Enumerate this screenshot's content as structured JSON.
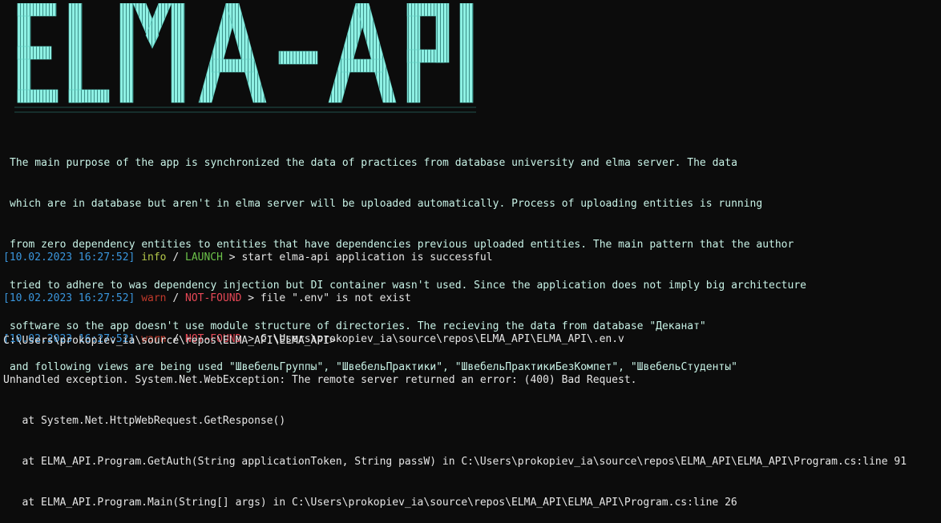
{
  "banner": {
    "text": "ELMA-API",
    "color": "#8ff1e4",
    "shadow": "#3fa7a0"
  },
  "description": [
    "The main purpose of the app is synchronized the data of practices from database university and elma server. The data",
    "which are in database but aren't in elma server will be uploaded automatically. Process of uploading entities is running",
    "from zero dependency entities to entities that have dependencies previous uploaded entities. The main pattern that the author",
    "tried to adhere to was dependency injection but DI container wasn't used. Since the application does not imply big architecture",
    "software so the app doesn't use module structure of directories. The recieving the data from database \"Деканат\"",
    "and following views are being used \"ШвебельГруппы\", \"ШвебельПрактики\", \"ШвебельПрактикиБезКомпет\", \"ШвебельСтуденты\""
  ],
  "logs": [
    {
      "timestamp": "[10.02.2023 16:27:52]",
      "level": "info",
      "tag": "LAUNCH",
      "message": " > start elma-api application is successful"
    },
    {
      "timestamp": "[10.02.2023 16:27:52]",
      "level": "warn",
      "tag": "NOT-FOUND",
      "message": " > file \".env\" is not exist"
    },
    {
      "timestamp": "[10.02.2023 16:27:52]",
      "level": "warn",
      "tag": "NOT-FOUND",
      "message": " > C:\\Users\\prokopiev_ia\\source\\repos\\ELMA_API\\ELMA_API\\.en.v"
    }
  ],
  "exception": [
    "Unhandled exception. System.Net.WebException: The remote server returned an error: (400) Bad Request.",
    "   at System.Net.HttpWebRequest.GetResponse()",
    "   at ELMA_API.Program.GetAuth(String applicationToken, String passW) in C:\\Users\\prokopiev_ia\\source\\repos\\ELMA_API\\ELMA_API\\Program.cs:line 91",
    "   at ELMA_API.Program.Main(String[] args) in C:\\Users\\prokopiev_ia\\source\\repos\\ELMA_API\\ELMA_API\\Program.cs:line 26"
  ],
  "prompt": "C:\\Users\\prokopiev_ia\\source\\repos\\ELMA_API\\ELMA_API>",
  "separator": " / "
}
